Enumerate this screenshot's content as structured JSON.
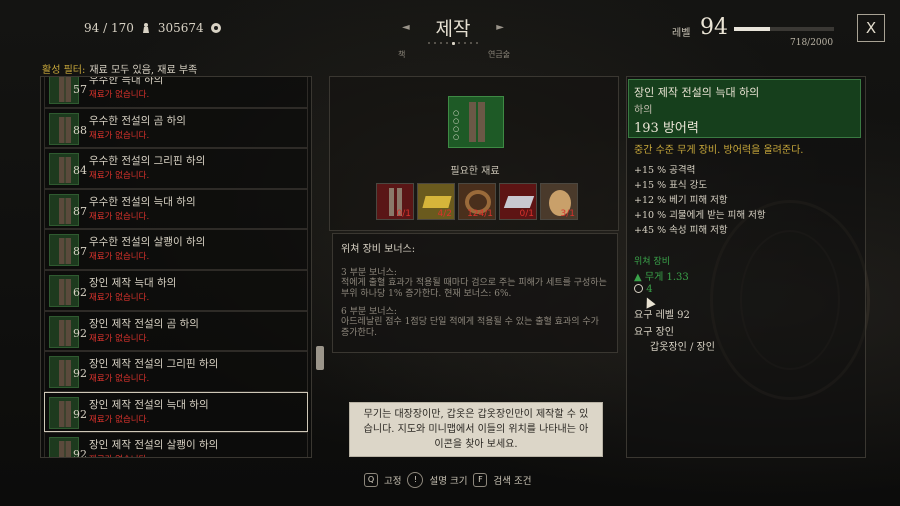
{
  "header": {
    "inventory": "94 / 170",
    "gold": "305674",
    "title": "제작",
    "prev_tab": "책",
    "next_tab": "연금술",
    "level_label": "레벨",
    "level": "94",
    "xp_text": "718/2000",
    "xp_fraction": 0.359,
    "close_label": "X"
  },
  "filter": {
    "label": "활성 필터:",
    "value": "재료 모두 있음, 재료 부족"
  },
  "recipes": [
    {
      "level": "57",
      "name": "우수한 늑대 하의",
      "status": "재료가 없습니다."
    },
    {
      "level": "88",
      "name": "우수한 전설의 곰 하의",
      "status": "재료가 없습니다."
    },
    {
      "level": "84",
      "name": "우수한 전설의 그리핀 하의",
      "status": "재료가 없습니다."
    },
    {
      "level": "87",
      "name": "우수한 전설의 늑대 하의",
      "status": "재료가 없습니다."
    },
    {
      "level": "87",
      "name": "우수한 전설의 살쾡이 하의",
      "status": "재료가 없습니다."
    },
    {
      "level": "62",
      "name": "장인 제작 늑대 하의",
      "status": "재료가 없습니다."
    },
    {
      "level": "92",
      "name": "장인 제작 전설의 곰 하의",
      "status": "재료가 없습니다."
    },
    {
      "level": "92",
      "name": "장인 제작 전설의 그리핀 하의",
      "status": "재료가 없습니다."
    },
    {
      "level": "92",
      "name": "장인 제작 전설의 늑대 하의",
      "status": "재료가 없습니다."
    },
    {
      "level": "92",
      "name": "장인 제작 전설의 살쾡이 하의",
      "status": "재료가 없습니다."
    }
  ],
  "center": {
    "required_title": "필요한 재료",
    "materials": [
      {
        "icon": "trousers-icon",
        "count": "0/1"
      },
      {
        "icon": "gold-ingot-icon",
        "count": "4/2"
      },
      {
        "icon": "leather-strap-icon",
        "count": "124/1"
      },
      {
        "icon": "silver-ingot-icon",
        "count": "0/1"
      },
      {
        "icon": "monster-egg-icon",
        "count": "3/1"
      }
    ],
    "bonus_title": "위쳐 장비 보너스:",
    "set3_head": "3 부분 보너스:",
    "set3_desc": "적에게 출혈 효과가 적용될 때마다 검으로 주는 피해가 세트를 구성하는 부위 하나당 1% 증가한다. 현재 보너스: 6%.",
    "set6_head": "6 부분 보너스:",
    "set6_desc": "아드레날린 점수 1점당 단일 적에게 적용될 수 있는 출혈 효과의 수가 증가한다."
  },
  "item": {
    "name": "장인 제작 전설의 늑대 하의",
    "type": "하의",
    "armor": "193 방어력",
    "desc": "중간 수준 무게 장비. 방어력을 올려준다.",
    "stats": [
      "+15 % 공격력",
      "+15 % 표식 강도",
      "+12 % 베기 피해 저항",
      "+10 % 괴물에게 받는 피해 저항",
      "+45 % 속성 피해 저항"
    ],
    "set_label": "위쳐 장비",
    "weight": "무게  1.33",
    "gem": "4",
    "req_level": "요구 레벨 92",
    "req_craftsman": "요구 장인",
    "craftsman": "갑옷장인 / 장인"
  },
  "hint": "무기는 대장장이만, 갑옷은 갑옷장인만이 제작할 수 있습니다. 지도와 미니맵에서 이들의 위치를 나타내는 아이콘을 찾아 보세요.",
  "footer": {
    "key1": "Q",
    "label1": "고정",
    "key2": "!",
    "label2": "설명 크기",
    "key3": "F",
    "label3": "검색 조건"
  }
}
